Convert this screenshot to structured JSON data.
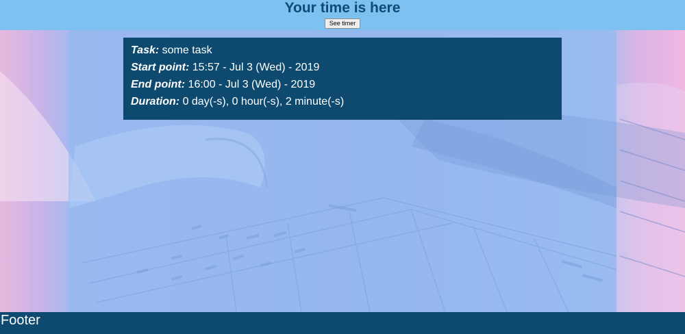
{
  "header": {
    "title": "Your time is here",
    "see_timer_label": "See timer"
  },
  "task_card": {
    "task_label": "Task:",
    "task_value": "some task",
    "start_label": "Start point:",
    "start_value": "15:57 - Jul 3 (Wed) - 2019",
    "end_label": "End point:",
    "end_value": "16:00 - Jul 3 (Wed) - 2019",
    "duration_label": "Duration:",
    "duration_value": "0 day(-s), 0 hour(-s), 2 minute(-s)"
  },
  "footer": {
    "text": "Footer"
  },
  "colors": {
    "header_bg": "#7cc1ef",
    "header_title": "#0e4a78",
    "card_bg": "#0e4a70",
    "footer_bg": "#0e4a70"
  }
}
